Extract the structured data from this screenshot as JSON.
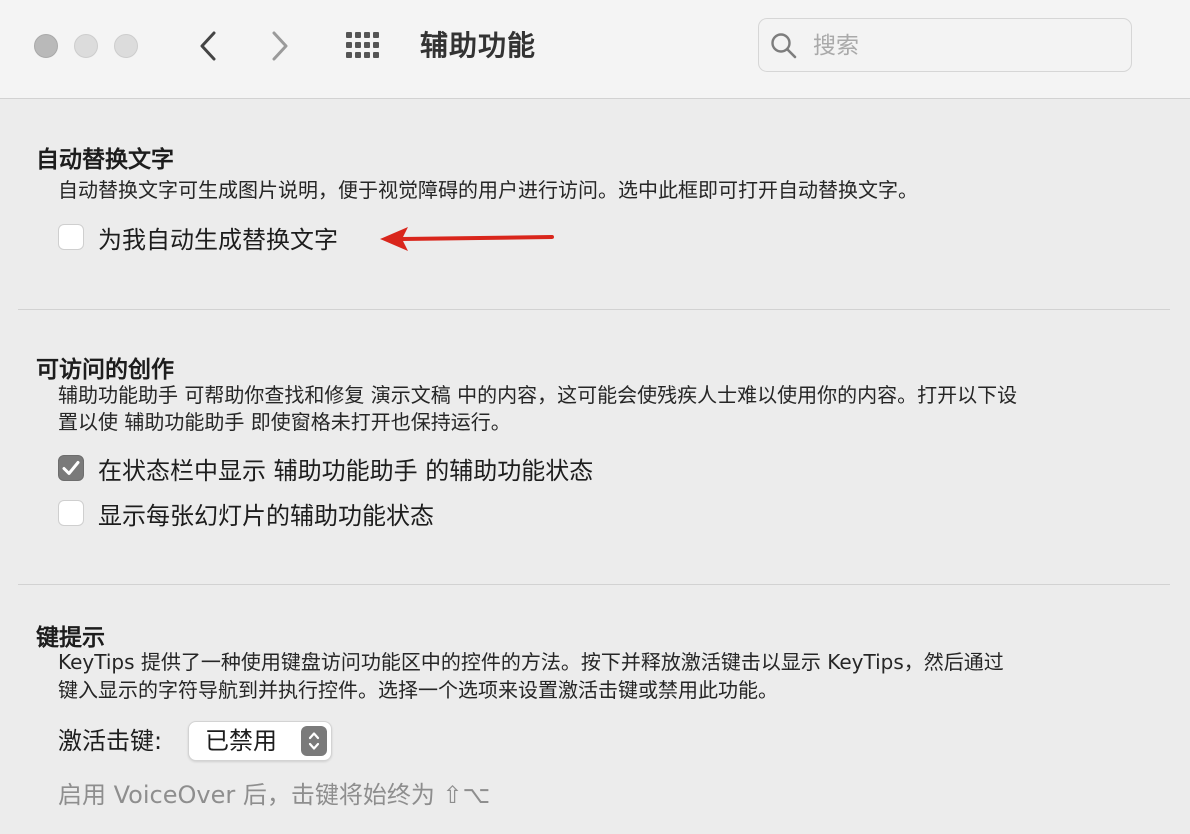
{
  "window": {
    "title": "辅助功能",
    "search_placeholder": "搜索"
  },
  "alt_text": {
    "title": "自动替换文字",
    "description": "自动替换文字可生成图片说明，便于视觉障碍的用户进行访问。选中此框即可打开自动替换文字。",
    "checkbox_label": "为我自动生成替换文字",
    "checkbox_checked": false,
    "annotation_arrow_color": "#d9261c"
  },
  "accessible_authoring": {
    "title": "可访问的创作",
    "description_line1": "辅助功能助手 可帮助你查找和修复 演示文稿 中的内容，这可能会使残疾人士难以使用你的内容。打开以下设",
    "description_line2": "置以使 辅助功能助手 即使窗格未打开也保持运行。",
    "checkboxes": [
      {
        "label": "在状态栏中显示 辅助功能助手 的辅助功能状态",
        "checked": true
      },
      {
        "label": "显示每张幻灯片的辅助功能状态",
        "checked": false
      }
    ]
  },
  "keytips": {
    "title": "键提示",
    "description_line1": "KeyTips 提供了一种使用键盘访问功能区中的控件的方法。按下并释放激活键击以显示 KeyTips，然后通过",
    "description_line2": "键入显示的字符导航到并执行控件。选择一个选项来设置激活击键或禁用此功能。",
    "select_label": "激活击键:",
    "select_value": "已禁用",
    "footnote": "启用 VoiceOver 后，击键将始终为 ⇧⌥"
  },
  "icons": {
    "back": "chevron-left-icon",
    "forward": "chevron-right-icon",
    "grid": "grid-icon",
    "search": "search-icon",
    "checkmark": "checkmark-icon",
    "stepper": "up-down-chevron-icon"
  }
}
